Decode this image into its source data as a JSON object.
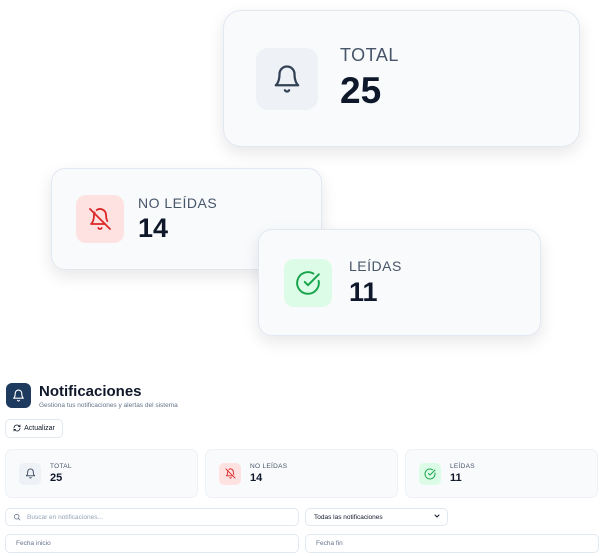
{
  "showcase": {
    "total": {
      "label": "TOTAL",
      "value": "25",
      "icon": "bell-icon"
    },
    "unread": {
      "label": "NO LEÍDAS",
      "value": "14",
      "icon": "bell-off-icon"
    },
    "read": {
      "label": "LEÍDAS",
      "value": "11",
      "icon": "check-circle-icon"
    }
  },
  "header": {
    "title": "Notificaciones",
    "subtitle": "Gestiona tus notificaciones y alertas del sistema",
    "refresh_label": "Actualizar"
  },
  "stats": {
    "total": {
      "label": "TOTAL",
      "value": "25"
    },
    "unread": {
      "label": "NO LEÍDAS",
      "value": "14"
    },
    "read": {
      "label": "LEÍDAS",
      "value": "11"
    }
  },
  "filters": {
    "search_placeholder": "Buscar en notificaciones...",
    "type_selected": "Todas las notificaciones",
    "date_start_placeholder": "Fecha inicio",
    "date_end_placeholder": "Fecha fin"
  },
  "colors": {
    "brand": "#1e3a5f",
    "unread_bg": "#fee2e2",
    "unread_fg": "#dc2626",
    "read_bg": "#dcfce7",
    "read_fg": "#16a34a",
    "neutral_icon": "#334155"
  }
}
